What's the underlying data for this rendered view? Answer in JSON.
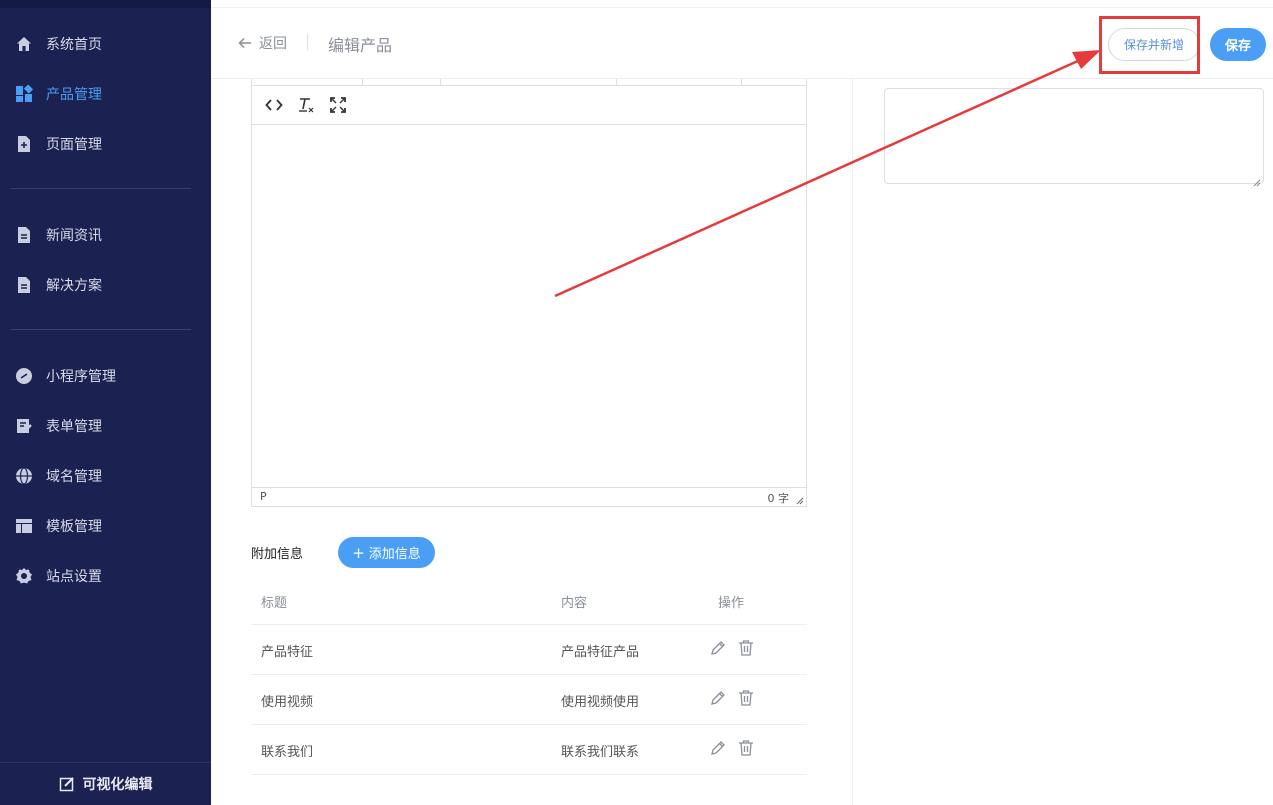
{
  "sidebar": {
    "items": [
      {
        "label": "系统首页",
        "icon": "home-icon"
      },
      {
        "label": "产品管理",
        "icon": "dashboard-icon",
        "active": true
      },
      {
        "label": "页面管理",
        "icon": "page-add-icon"
      },
      {
        "label": "新闻资讯",
        "icon": "document-icon"
      },
      {
        "label": "解决方案",
        "icon": "document-icon"
      },
      {
        "label": "小程序管理",
        "icon": "link-icon"
      },
      {
        "label": "表单管理",
        "icon": "form-edit-icon"
      },
      {
        "label": "域名管理",
        "icon": "globe-icon"
      },
      {
        "label": "模板管理",
        "icon": "layout-icon"
      },
      {
        "label": "站点设置",
        "icon": "gear-icon"
      }
    ],
    "bottom_label": "可视化编辑"
  },
  "header": {
    "back_label": "返回",
    "title": "编辑产品",
    "save_new_label": "保存并新增",
    "save_label": "保存"
  },
  "editor": {
    "tools": [
      "code-icon",
      "clear-format-icon",
      "fullscreen-icon"
    ],
    "path": "P",
    "word_count": "0 字"
  },
  "extra": {
    "label": "附加信息",
    "add_label": "添加信息",
    "columns": [
      "标题",
      "内容",
      "操作"
    ],
    "rows": [
      {
        "title": "产品特征",
        "content": "产品特征产品"
      },
      {
        "title": "使用视频",
        "content": "使用视频使用"
      },
      {
        "title": "联系我们",
        "content": "联系我们联系"
      }
    ]
  },
  "colors": {
    "sidebar_bg": "#1b2150",
    "accent": "#4a9ff5",
    "annotation": "#e63b3b"
  }
}
